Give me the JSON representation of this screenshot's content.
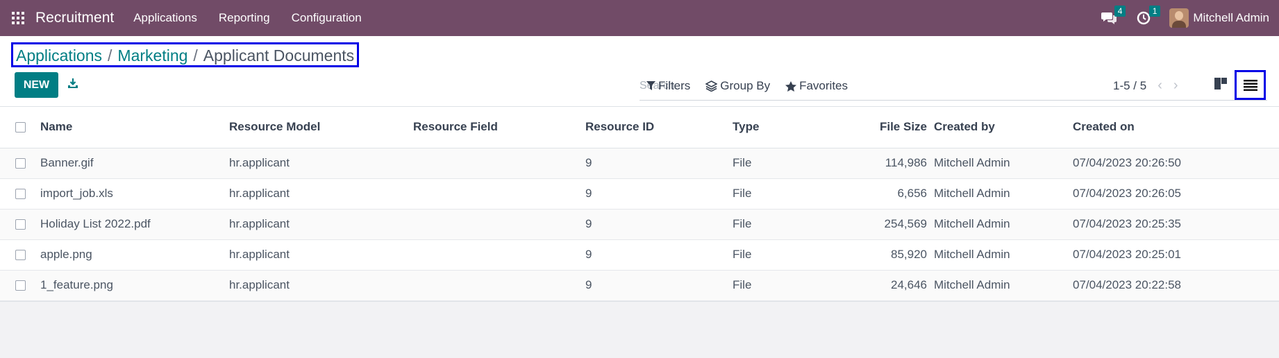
{
  "navbar": {
    "app_name": "Recruitment",
    "menu": [
      "Applications",
      "Reporting",
      "Configuration"
    ],
    "messages_count": "4",
    "activities_count": "1",
    "user_name": "Mitchell Admin"
  },
  "breadcrumb": {
    "items": [
      "Applications",
      "Marketing"
    ],
    "separator": "/",
    "current": "Applicant Documents"
  },
  "toolbar": {
    "new_label": "NEW"
  },
  "search": {
    "placeholder": "Search..."
  },
  "filters": {
    "filters_label": "Filters",
    "groupby_label": "Group By",
    "favorites_label": "Favorites"
  },
  "pager": {
    "range": "1-5 / 5"
  },
  "table": {
    "columns": [
      "Name",
      "Resource Model",
      "Resource Field",
      "Resource ID",
      "Type",
      "File Size",
      "Created by",
      "Created on"
    ],
    "rows": [
      {
        "name": "Banner.gif",
        "res_model": "hr.applicant",
        "res_field": "",
        "res_id": "9",
        "type": "File",
        "file_size": "114,986",
        "created_by": "Mitchell Admin",
        "created_on": "07/04/2023 20:26:50"
      },
      {
        "name": "import_job.xls",
        "res_model": "hr.applicant",
        "res_field": "",
        "res_id": "9",
        "type": "File",
        "file_size": "6,656",
        "created_by": "Mitchell Admin",
        "created_on": "07/04/2023 20:26:05"
      },
      {
        "name": "Holiday List 2022.pdf",
        "res_model": "hr.applicant",
        "res_field": "",
        "res_id": "9",
        "type": "File",
        "file_size": "254,569",
        "created_by": "Mitchell Admin",
        "created_on": "07/04/2023 20:25:35"
      },
      {
        "name": "apple.png",
        "res_model": "hr.applicant",
        "res_field": "",
        "res_id": "9",
        "type": "File",
        "file_size": "85,920",
        "created_by": "Mitchell Admin",
        "created_on": "07/04/2023 20:25:01"
      },
      {
        "name": "1_feature.png",
        "res_model": "hr.applicant",
        "res_field": "",
        "res_id": "9",
        "type": "File",
        "file_size": "24,646",
        "created_by": "Mitchell Admin",
        "created_on": "07/04/2023 20:22:58"
      }
    ]
  },
  "colors": {
    "navbar": "#714b67",
    "primary": "#017e84",
    "highlight_box": "#0000e6"
  },
  "icons": {
    "apps": "apps-grid-icon",
    "messages": "chat-icon",
    "activities": "clock-icon",
    "download": "download-icon",
    "search": "search-icon",
    "filter": "filter-icon",
    "group_by": "layers-icon",
    "favorites": "star-icon",
    "kanban": "kanban-view-icon",
    "list": "list-view-icon"
  }
}
